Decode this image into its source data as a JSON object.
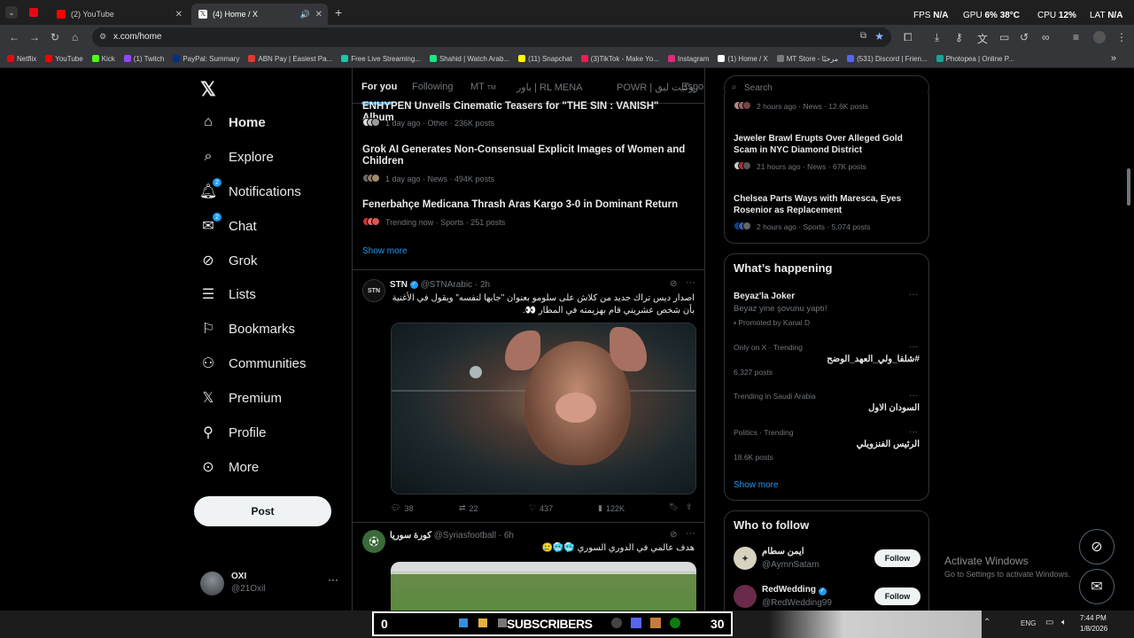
{
  "browser": {
    "tabs": [
      {
        "label": "(2) YouTube"
      },
      {
        "label": "(4) Home / X"
      }
    ],
    "url": "x.com/home",
    "bookmarks": [
      "Netflix",
      "YouTube",
      "Kick",
      "(1) Twitch",
      "PayPal: Summary",
      "ABN Pay | Easiest Pa...",
      "Free Live Streaming...",
      "Shahid | Watch Arab...",
      "(11) Snapchat",
      "(3)TikTok - Make Yo...",
      "Instagram",
      "(1) Home / X",
      "MT Store - مرحبًا",
      "(531) Discord | Frien...",
      "Photopea | Online P..."
    ],
    "perf": {
      "fps_label": "FPS",
      "fps_val": "N/A",
      "gpu_label": "GPU",
      "gpu_pct": "6%",
      "gpu_temp": "38°C",
      "cpu_label": "CPU",
      "cpu_pct": "12%",
      "lat_label": "LAT",
      "lat_val": "N/A"
    }
  },
  "nav": {
    "items": [
      {
        "label": "Home"
      },
      {
        "label": "Explore"
      },
      {
        "label": "Notifications",
        "badge": "2"
      },
      {
        "label": "Chat",
        "badge": "2"
      },
      {
        "label": "Grok"
      },
      {
        "label": "Lists"
      },
      {
        "label": "Bookmarks"
      },
      {
        "label": "Communities"
      },
      {
        "label": "Premium"
      },
      {
        "label": "Profile"
      },
      {
        "label": "More"
      }
    ],
    "post_label": "Post",
    "account": {
      "name": "OXI",
      "handle": "@21Oxil"
    }
  },
  "feed": {
    "tabs": [
      "For you",
      "Following",
      "MT",
      "باور | RL MENA",
      "POWR | روكيت ليق",
      "Espor"
    ],
    "tab_mt_tag": "TM",
    "trends": [
      {
        "title": "ENHYPEN Unveils Cinematic Teasers for \"THE SIN : VANISH\" Album",
        "meta": "1 day ago · Other · 236K posts"
      },
      {
        "title": "Grok AI Generates Non-Consensual Explicit Images of Women and Children",
        "meta": "1 day ago · News · 494K posts"
      },
      {
        "title": "Fenerbahçe Medicana Thrash Aras Kargo 3-0 in Dominant Return",
        "meta": "Trending now · Sports · 251 posts"
      }
    ],
    "show_more": "Show more",
    "post1": {
      "name": "STN",
      "handle": "@STNArabic · 2h",
      "avatar_text": "STN",
      "text1": "اصدار ديس تراك جديد من كلاش على سلومو بعنوان \"جابها لنفسه\" ويقول في الأغنية",
      "text2": "بأن شخص عشريني قام بهزيمته في المطار 👀.",
      "replies": "38",
      "reposts": "22",
      "likes": "437",
      "views": "122K"
    },
    "post2": {
      "name": "كورة سوريا",
      "handle": "@Syriasfootball · 6h",
      "text": "هدف عالمي في الدوري السوري 🥶🥶🥲"
    }
  },
  "right": {
    "search_placeholder": "Search",
    "trends": [
      {
        "meta": "2 hours ago · News · 12.6K posts"
      },
      {
        "title": "Jeweler Brawl Erupts Over Alleged Gold Scam in NYC Diamond District",
        "meta": "21 hours ago · News · 67K posts"
      },
      {
        "title": "Chelsea Parts Ways with Maresca, Eyes Rosenior as Replacement",
        "meta": "2 hours ago · Sports · 5,074 posts"
      }
    ],
    "happening_title": "What’s happening",
    "happening": [
      {
        "title": "Beyaz'la Joker",
        "sub": "Beyaz yine şovunu yaptı!",
        "promo": "Promoted by Kanal D"
      },
      {
        "cat": "Only on X · Trending",
        "name": "#شلفا_ولي_العهد_الوضح",
        "count": "6,327 posts"
      },
      {
        "cat": "Trending in Saudi Arabia",
        "name": "السودان الاول"
      },
      {
        "cat": "Politics · Trending",
        "name": "الرئيس الفنزويلي",
        "count": "18.6K posts"
      }
    ],
    "happening_more": "Show more",
    "who_title": "Who to follow",
    "who": [
      {
        "name": "ايمن سطام",
        "handle": "@AymnSatam",
        "btn": "Follow"
      },
      {
        "name": "RedWedding",
        "handle": "@RedWedding99",
        "btn": "Follow"
      }
    ]
  },
  "watermark": {
    "line1": "Activate Windows",
    "line2": "Go to Settings to activate Windows."
  },
  "taskbar": {
    "sub_left": "0",
    "sub_label": "SUBSCRIBERS",
    "sub_right": "30",
    "lang": "ENG",
    "time": "7:44 PM",
    "date": "1/8/2026"
  },
  "colors": {
    "accent": "#1d9bf0",
    "bg": "#000000",
    "border": "#2f3336",
    "muted": "#71767b"
  }
}
